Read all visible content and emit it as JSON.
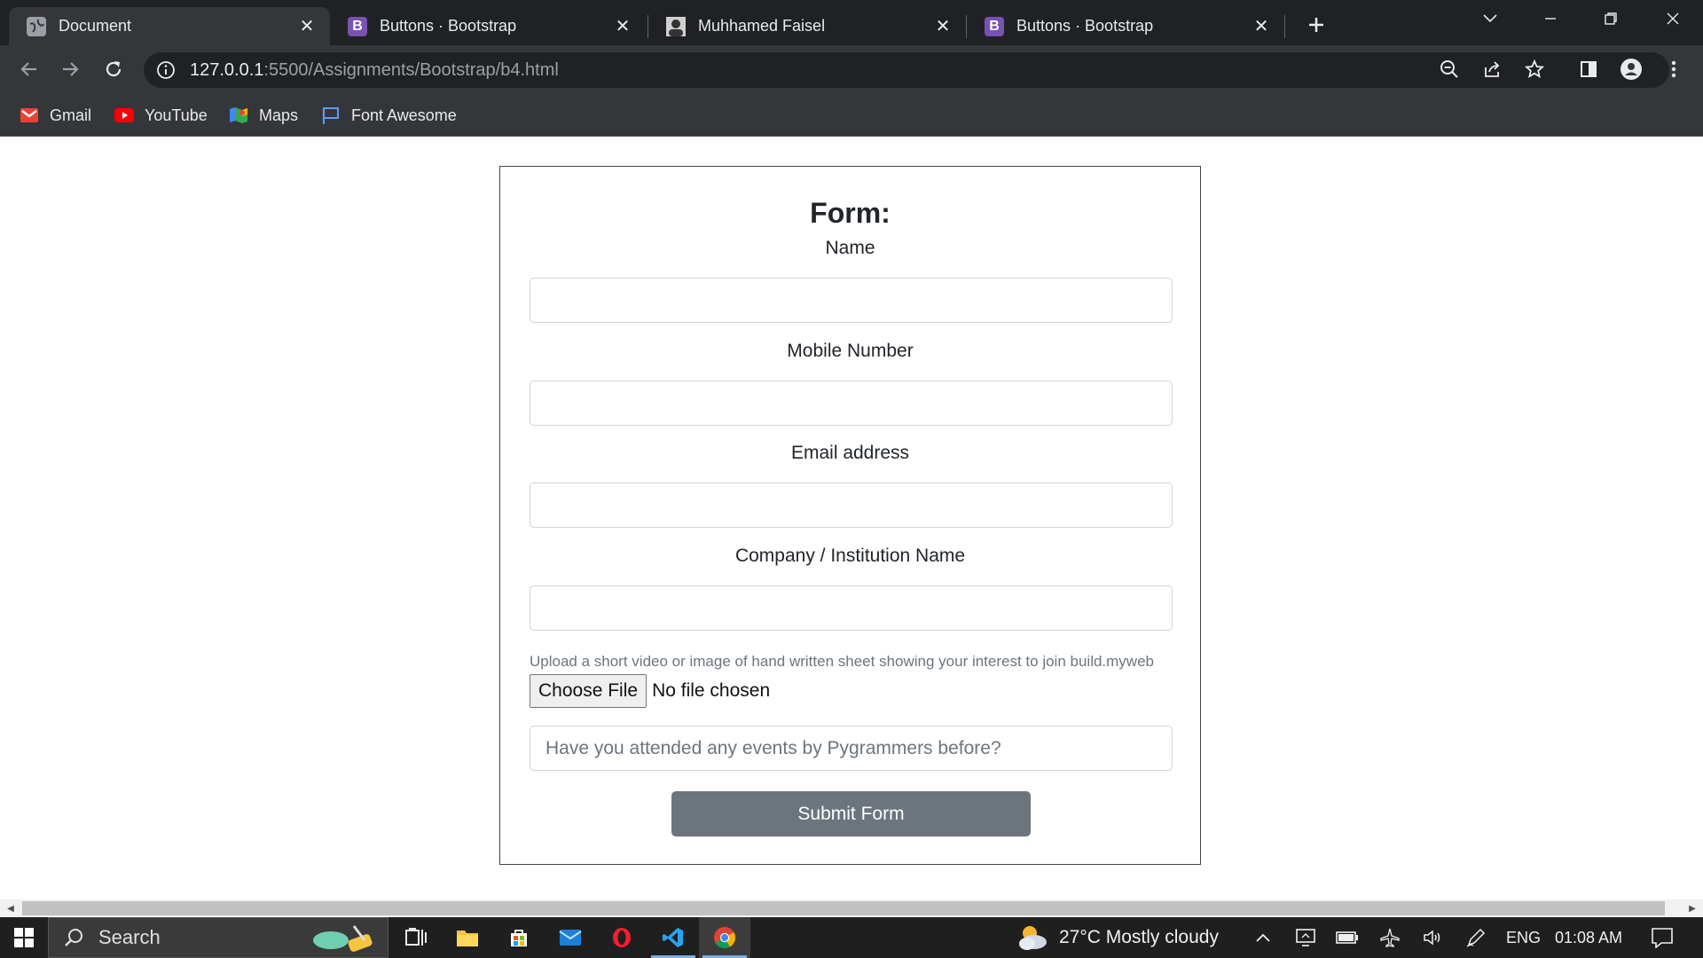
{
  "browser": {
    "tabs": [
      {
        "title": "Document",
        "favicon": "globe-icon",
        "active": true
      },
      {
        "title": "Buttons · Bootstrap",
        "favicon": "bootstrap-icon",
        "favicon_letter": "B",
        "active": false
      },
      {
        "title": "Muhhamed Faisel",
        "favicon": "profile-photo-icon",
        "active": false
      },
      {
        "title": "Buttons · Bootstrap",
        "favicon": "bootstrap-icon",
        "favicon_letter": "B",
        "active": false
      }
    ],
    "url": {
      "host": "127.0.0.1",
      "path": ":5500/Assignments/Bootstrap/b4.html"
    },
    "bookmarks": [
      {
        "label": "Gmail",
        "icon": "gmail-icon"
      },
      {
        "label": "YouTube",
        "icon": "youtube-icon"
      },
      {
        "label": "Maps",
        "icon": "maps-icon"
      },
      {
        "label": "Font Awesome",
        "icon": "flag-icon"
      }
    ]
  },
  "form": {
    "title": "Form:",
    "fields": [
      {
        "label": "Name",
        "value": ""
      },
      {
        "label": "Mobile Number",
        "value": ""
      },
      {
        "label": "Email address",
        "value": ""
      },
      {
        "label": "Company / Institution Name",
        "value": ""
      }
    ],
    "upload_hint": "Upload a short video or image of hand written sheet showing your interest to join build.myweb",
    "file_button": "Choose File",
    "file_status": "No file chosen",
    "events_placeholder": "Have you attended any events by Pygrammers before?",
    "submit_label": "Submit Form"
  },
  "taskbar": {
    "search_label": "Search",
    "weather": "27°C  Mostly cloudy",
    "language": "ENG",
    "time": "01:08 AM"
  },
  "colors": {
    "chrome_dark": "#202124",
    "chrome_toolbar": "#35363a",
    "bootstrap_purple": "#7952b3",
    "submit_gray": "#6c757d",
    "taskbar": "#1f1f1f"
  }
}
